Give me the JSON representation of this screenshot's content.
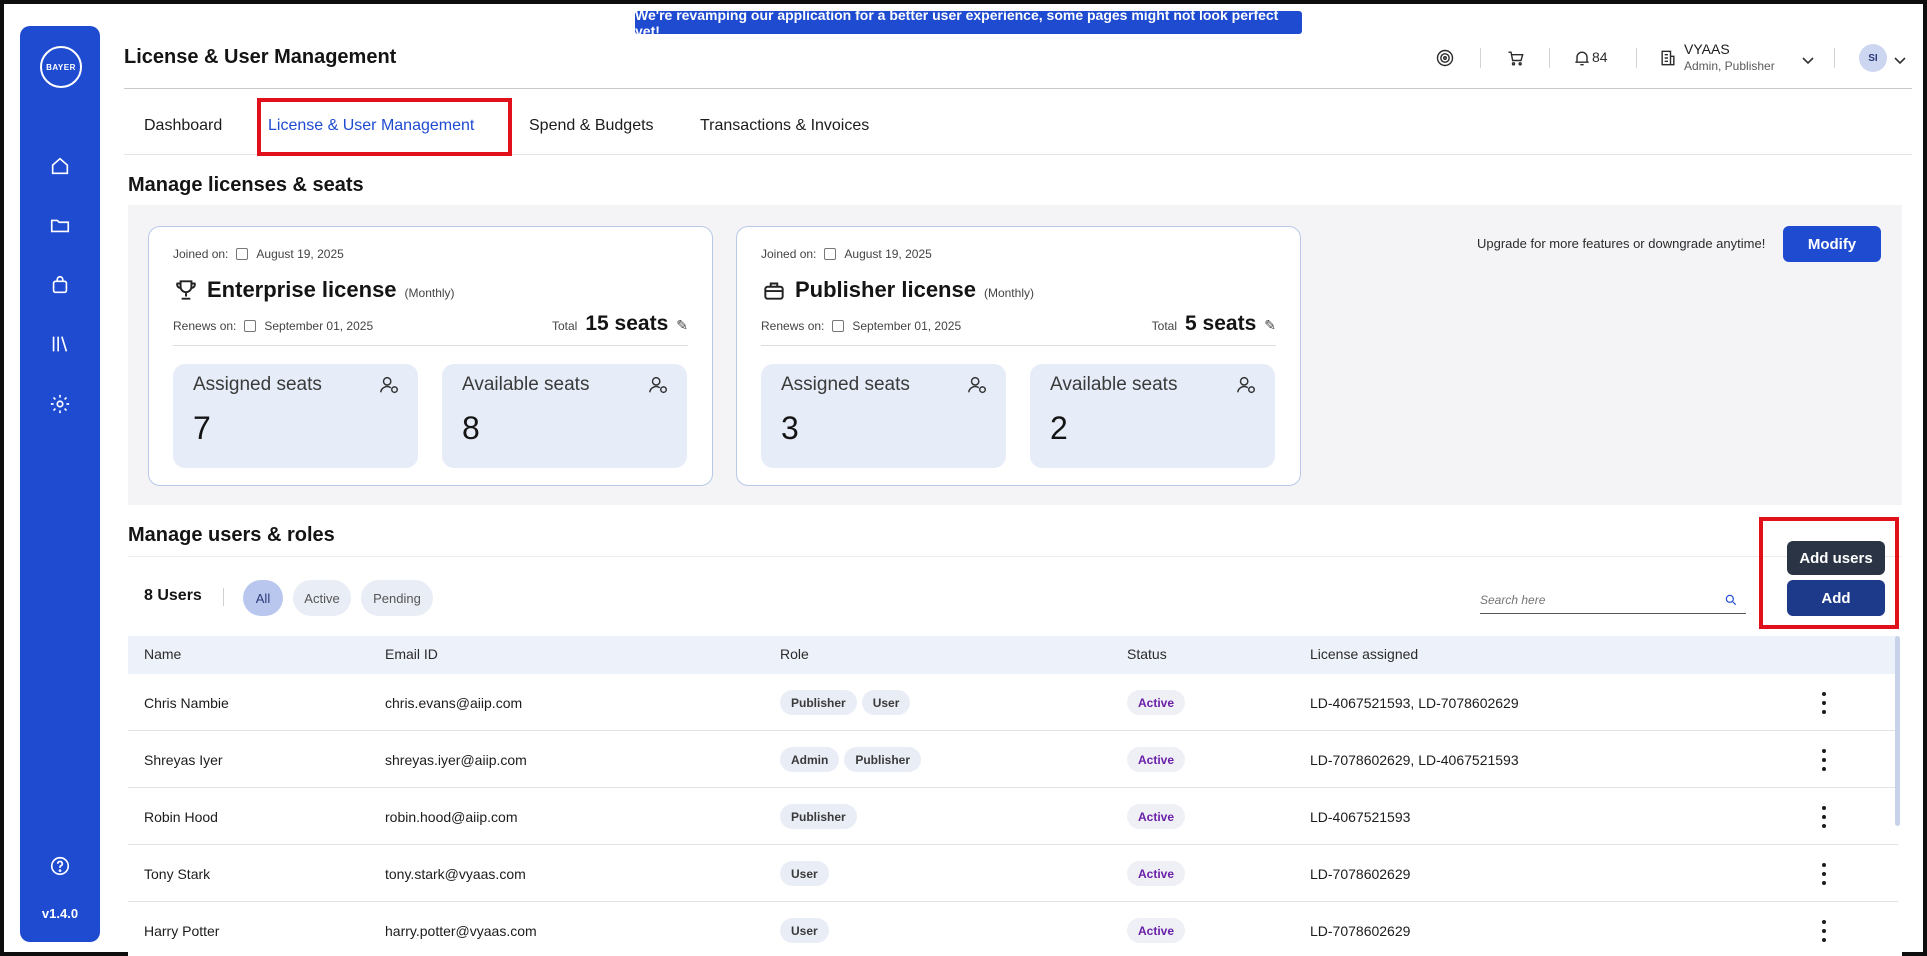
{
  "banner": "We're revamping our application for a better user experience, some pages might not look perfect yet!",
  "sidebar": {
    "logo_text": "BAYER",
    "items": [
      "home-icon",
      "folder-icon",
      "bag-icon",
      "library-icon",
      "settings-icon"
    ],
    "help_icon": "help-icon",
    "version": "v1.4.0"
  },
  "header": {
    "title": "License & User Management",
    "notifications_count": "84",
    "org_name": "VYAAS",
    "org_role": "Admin, Publisher",
    "avatar_initials": "SI"
  },
  "tabs": [
    {
      "label": "Dashboard"
    },
    {
      "label": "License & User Management"
    },
    {
      "label": "Spend & Budgets"
    },
    {
      "label": "Transactions & Invoices"
    }
  ],
  "licenses": {
    "section_title": "Manage licenses & seats",
    "upgrade_text": "Upgrade for more features or downgrade anytime!",
    "modify_label": "Modify",
    "cards": [
      {
        "joined_label": "Joined on:",
        "joined_date": "August 19, 2025",
        "name": "Enterprise license",
        "period": "(Monthly)",
        "renews_label": "Renews on:",
        "renews_date": "September 01, 2025",
        "total_label": "Total",
        "total_seats": "15 seats",
        "assigned_label": "Assigned seats",
        "assigned_value": "7",
        "available_label": "Available seats",
        "available_value": "8"
      },
      {
        "joined_label": "Joined on:",
        "joined_date": "August 19, 2025",
        "name": "Publisher license",
        "period": "(Monthly)",
        "renews_label": "Renews on:",
        "renews_date": "September 01, 2025",
        "total_label": "Total",
        "total_seats": "5 seats",
        "assigned_label": "Assigned seats",
        "assigned_value": "3",
        "available_label": "Available seats",
        "available_value": "2"
      }
    ]
  },
  "users": {
    "section_title": "Manage users & roles",
    "count_label": "8 Users",
    "filters": [
      "All",
      "Active",
      "Pending"
    ],
    "search_placeholder": "Search here",
    "add_tooltip": "Add users",
    "add_label": "Add",
    "columns": [
      "Name",
      "Email ID",
      "Role",
      "Status",
      "License assigned"
    ],
    "rows": [
      {
        "name": "Chris Nambie",
        "email": "chris.evans@aiip.com",
        "roles": [
          "Publisher",
          "User"
        ],
        "status": "Active",
        "license": "LD-4067521593, LD-7078602629"
      },
      {
        "name": "Shreyas Iyer",
        "email": "shreyas.iyer@aiip.com",
        "roles": [
          "Admin",
          "Publisher"
        ],
        "status": "Active",
        "license": "LD-7078602629, LD-4067521593"
      },
      {
        "name": "Robin Hood",
        "email": "robin.hood@aiip.com",
        "roles": [
          "Publisher"
        ],
        "status": "Active",
        "license": "LD-4067521593"
      },
      {
        "name": "Tony Stark",
        "email": "tony.stark@vyaas.com",
        "roles": [
          "User"
        ],
        "status": "Active",
        "license": "LD-7078602629"
      },
      {
        "name": "Harry Potter",
        "email": "harry.potter@vyaas.com",
        "roles": [
          "User"
        ],
        "status": "Active",
        "license": "LD-7078602629"
      }
    ]
  }
}
